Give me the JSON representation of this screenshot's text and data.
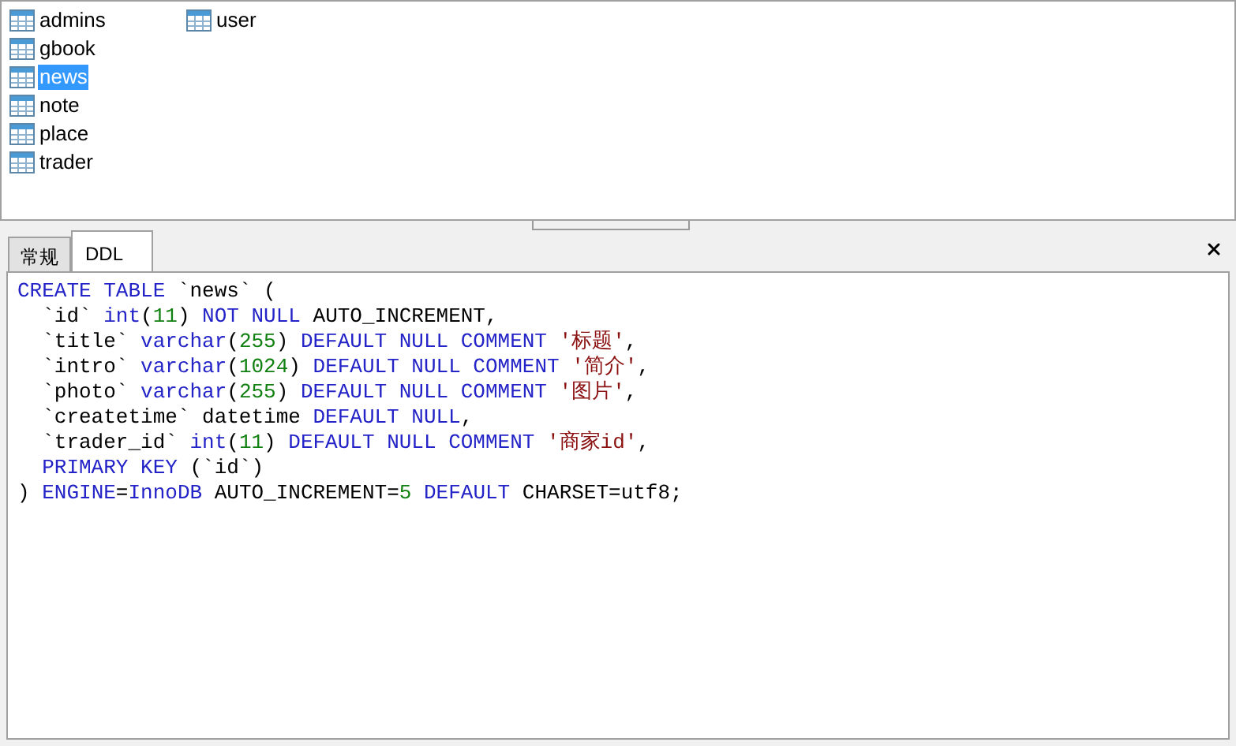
{
  "tables": [
    {
      "name": "admins",
      "selected": false
    },
    {
      "name": "gbook",
      "selected": false
    },
    {
      "name": "news",
      "selected": true
    },
    {
      "name": "note",
      "selected": false
    },
    {
      "name": "place",
      "selected": false
    },
    {
      "name": "trader",
      "selected": false
    },
    {
      "name": "user",
      "selected": false
    }
  ],
  "tabs": [
    {
      "label": "常规",
      "selected": false
    },
    {
      "label": "DDL",
      "selected": true
    }
  ],
  "ddl_lines": [
    [
      {
        "text": "CREATE TABLE",
        "kind": "kw"
      },
      {
        "text": " `news` (",
        "kind": "plain"
      }
    ],
    [
      {
        "text": "  `id` ",
        "kind": "plain"
      },
      {
        "text": "int",
        "kind": "kw"
      },
      {
        "text": "(",
        "kind": "plain"
      },
      {
        "text": "11",
        "kind": "num"
      },
      {
        "text": ") ",
        "kind": "plain"
      },
      {
        "text": "NOT NULL",
        "kind": "kw"
      },
      {
        "text": " AUTO_INCREMENT,",
        "kind": "plain"
      }
    ],
    [
      {
        "text": "  `title` ",
        "kind": "plain"
      },
      {
        "text": "varchar",
        "kind": "kw"
      },
      {
        "text": "(",
        "kind": "plain"
      },
      {
        "text": "255",
        "kind": "num"
      },
      {
        "text": ") ",
        "kind": "plain"
      },
      {
        "text": "DEFAULT NULL COMMENT ",
        "kind": "kw"
      },
      {
        "text": "'标题'",
        "kind": "str"
      },
      {
        "text": ",",
        "kind": "plain"
      }
    ],
    [
      {
        "text": "  `intro` ",
        "kind": "plain"
      },
      {
        "text": "varchar",
        "kind": "kw"
      },
      {
        "text": "(",
        "kind": "plain"
      },
      {
        "text": "1024",
        "kind": "num"
      },
      {
        "text": ") ",
        "kind": "plain"
      },
      {
        "text": "DEFAULT NULL COMMENT ",
        "kind": "kw"
      },
      {
        "text": "'简介'",
        "kind": "str"
      },
      {
        "text": ",",
        "kind": "plain"
      }
    ],
    [
      {
        "text": "  `photo` ",
        "kind": "plain"
      },
      {
        "text": "varchar",
        "kind": "kw"
      },
      {
        "text": "(",
        "kind": "plain"
      },
      {
        "text": "255",
        "kind": "num"
      },
      {
        "text": ") ",
        "kind": "plain"
      },
      {
        "text": "DEFAULT NULL COMMENT ",
        "kind": "kw"
      },
      {
        "text": "'图片'",
        "kind": "str"
      },
      {
        "text": ",",
        "kind": "plain"
      }
    ],
    [
      {
        "text": "  `createtime` datetime ",
        "kind": "plain"
      },
      {
        "text": "DEFAULT NULL",
        "kind": "kw"
      },
      {
        "text": ",",
        "kind": "plain"
      }
    ],
    [
      {
        "text": "  `trader_id` ",
        "kind": "plain"
      },
      {
        "text": "int",
        "kind": "kw"
      },
      {
        "text": "(",
        "kind": "plain"
      },
      {
        "text": "11",
        "kind": "num"
      },
      {
        "text": ") ",
        "kind": "plain"
      },
      {
        "text": "DEFAULT NULL COMMENT ",
        "kind": "kw"
      },
      {
        "text": "'商家id'",
        "kind": "str"
      },
      {
        "text": ",",
        "kind": "plain"
      }
    ],
    [
      {
        "text": "  PRIMARY KEY",
        "kind": "kw"
      },
      {
        "text": " (`id`)",
        "kind": "plain"
      }
    ],
    [
      {
        "text": ") ",
        "kind": "plain"
      },
      {
        "text": "ENGINE",
        "kind": "kw"
      },
      {
        "text": "=",
        "kind": "plain"
      },
      {
        "text": "InnoDB",
        "kind": "kw"
      },
      {
        "text": " AUTO_INCREMENT=",
        "kind": "plain"
      },
      {
        "text": "5",
        "kind": "num"
      },
      {
        "text": " DEFAULT",
        "kind": "kw"
      },
      {
        "text": " CHARSET=utf8;",
        "kind": "plain"
      }
    ]
  ]
}
